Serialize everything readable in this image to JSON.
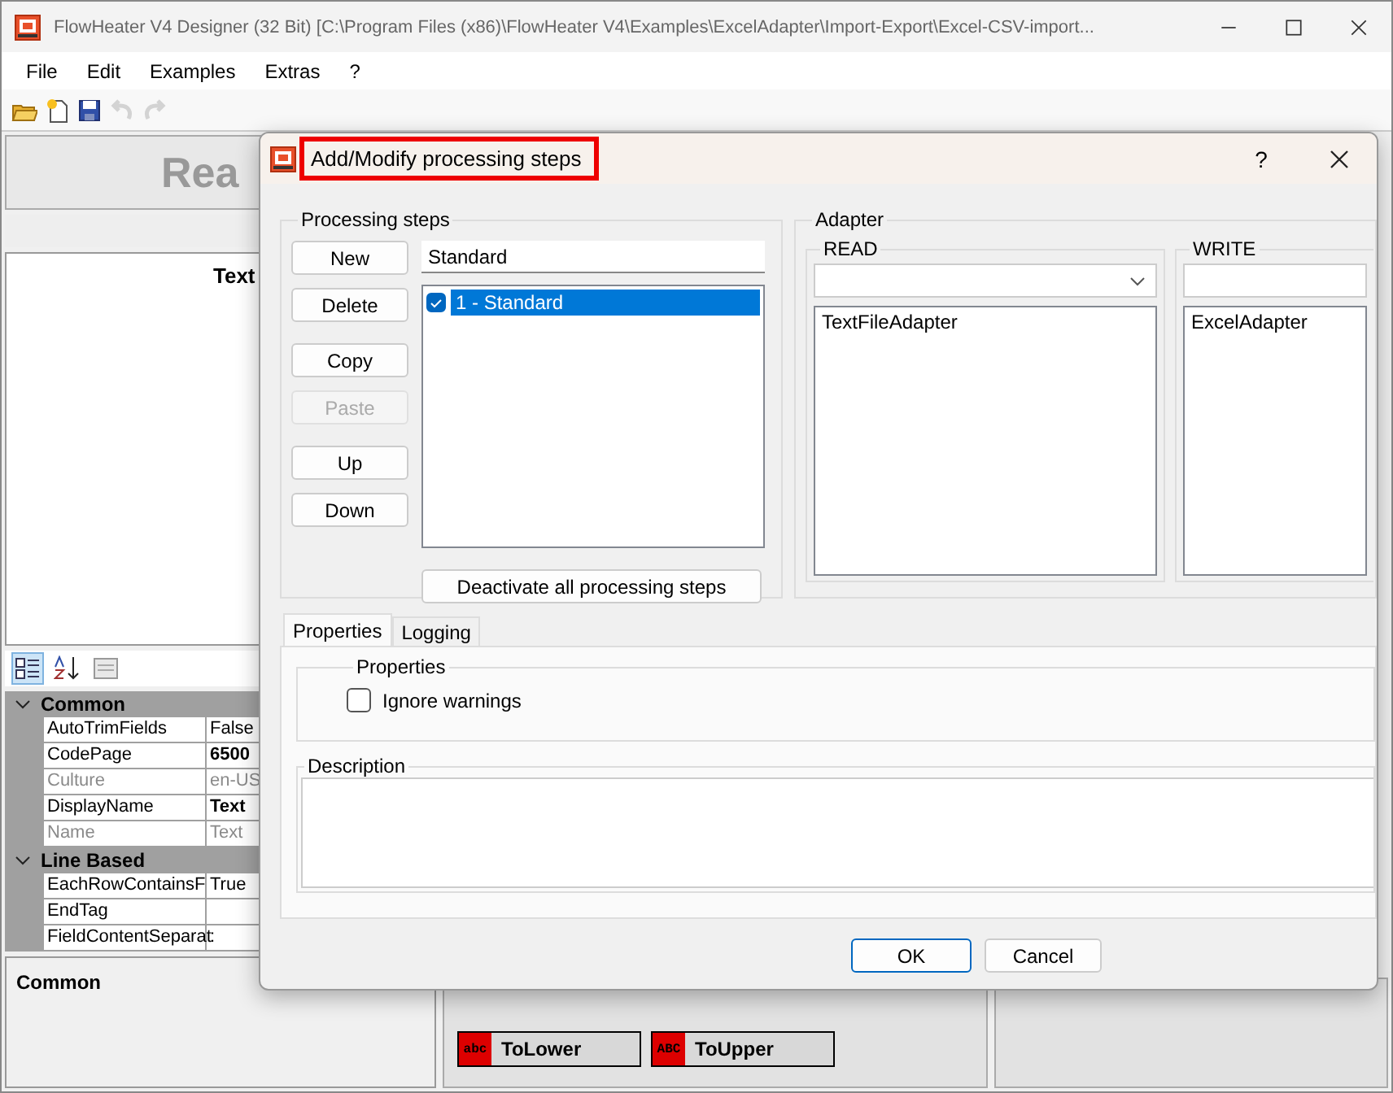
{
  "window": {
    "title": "FlowHeater V4 Designer (32 Bit) [C:\\Program Files (x86)\\FlowHeater V4\\Examples\\ExcelAdapter\\Import-Export\\Excel-CSV-import..."
  },
  "menu": [
    "File",
    "Edit",
    "Examples",
    "Extras",
    "?"
  ],
  "toolbar": [
    {
      "kind": "open",
      "disabled": false
    },
    {
      "kind": "new",
      "disabled": false
    },
    {
      "kind": "save",
      "disabled": false
    },
    {
      "kind": "undo",
      "disabled": true
    },
    {
      "kind": "redo",
      "disabled": true
    }
  ],
  "read_panel": {
    "header": "Rea",
    "node_title": "Text"
  },
  "property_grid": {
    "tools": [
      {
        "kind": "categorized",
        "selected": true
      },
      {
        "kind": "alphabetical",
        "selected": false
      },
      {
        "kind": "pages",
        "selected": false
      }
    ],
    "categories": [
      {
        "name": "Common",
        "expanded": true,
        "rows": [
          {
            "name": "AutoTrimFields",
            "value": "False",
            "bold": false,
            "readonly": false
          },
          {
            "name": "CodePage",
            "value": "6500",
            "bold": true,
            "readonly": false
          },
          {
            "name": "Culture",
            "value": "en-US",
            "bold": false,
            "readonly": true
          },
          {
            "name": "DisplayName",
            "value": "Text",
            "bold": true,
            "readonly": false
          },
          {
            "name": "Name",
            "value": "Text",
            "bold": false,
            "readonly": true
          }
        ]
      },
      {
        "name": "Line Based",
        "expanded": true,
        "rows": [
          {
            "name": "EachRowContainsF",
            "value": "True",
            "bold": false,
            "readonly": false
          },
          {
            "name": "EndTag",
            "value": "",
            "bold": false,
            "readonly": false
          },
          {
            "name": "FieldContentSeparat",
            "value": ":",
            "bold": false,
            "readonly": false
          }
        ]
      }
    ],
    "description": "Common"
  },
  "functions": [
    {
      "icon": "abc",
      "label": "ToLower"
    },
    {
      "icon": "ABC",
      "label": "ToUpper"
    }
  ],
  "dialog": {
    "title": "Add/Modify processing steps",
    "help": "?",
    "steps_group": "Processing steps",
    "button_groups": [
      [
        {
          "label": "New",
          "disabled": false
        },
        {
          "label": "Delete",
          "disabled": false
        }
      ],
      [
        {
          "label": "Copy",
          "disabled": false
        },
        {
          "label": "Paste",
          "disabled": true
        }
      ],
      [
        {
          "label": "Up",
          "disabled": false
        },
        {
          "label": "Down",
          "disabled": false
        }
      ]
    ],
    "name_field": "Standard",
    "steps": [
      {
        "label": "1 - Standard",
        "checked": true,
        "selected": true
      }
    ],
    "deactivate": "Deactivate all processing steps",
    "adapter_group": "Adapter",
    "read": {
      "label": "READ",
      "items": [
        "TextFileAdapter"
      ]
    },
    "write": {
      "label": "WRITE",
      "items": [
        "ExcelAdapter"
      ]
    },
    "tabs": [
      {
        "label": "Properties",
        "selected": true
      },
      {
        "label": "Logging",
        "selected": false
      }
    ],
    "properties_group": "Properties",
    "options": [
      {
        "label": "Ignore warnings",
        "checked": false
      }
    ],
    "description_group": "Description",
    "ok": "OK",
    "cancel": "Cancel"
  }
}
